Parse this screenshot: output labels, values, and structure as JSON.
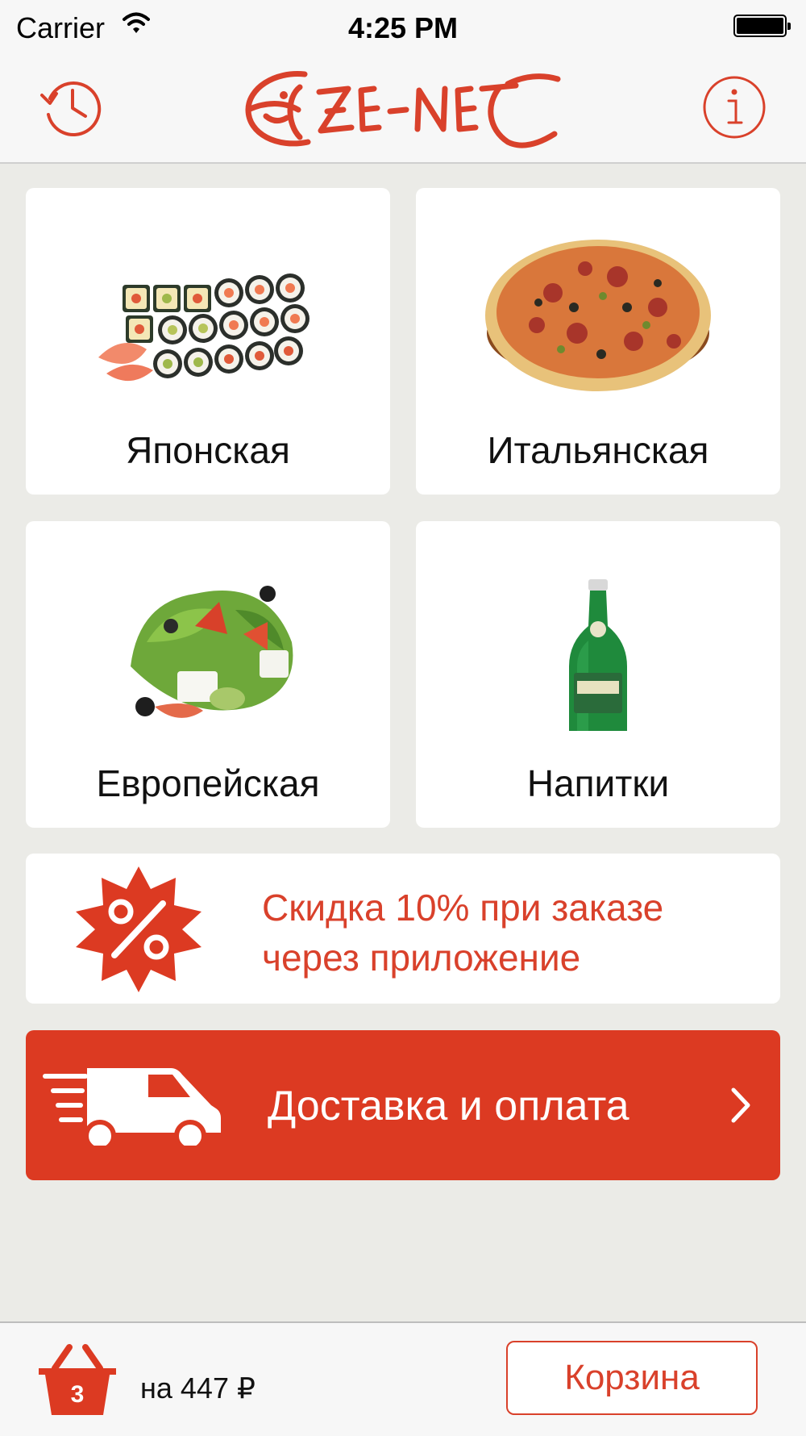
{
  "status_bar": {
    "carrier": "Carrier",
    "time": "4:25 PM"
  },
  "nav": {
    "brand": "ZENET",
    "history_icon": "history-clock-icon",
    "info_icon": "info-icon"
  },
  "categories": [
    {
      "label": "Японская",
      "icon": "sushi-image"
    },
    {
      "label": "Итальянская",
      "icon": "pizza-image"
    },
    {
      "label": "Европейская",
      "icon": "salad-image"
    },
    {
      "label": "Напитки",
      "icon": "bottle-image"
    }
  ],
  "promo": {
    "line1": "Скидка 10% при заказе",
    "line2": "через приложение",
    "icon": "percent-badge-icon"
  },
  "delivery": {
    "label": "Доставка и оплата",
    "icon": "delivery-truck-icon",
    "chevron": "chevron-right-icon"
  },
  "cart": {
    "count": "3",
    "total": "на 447 ₽",
    "button": "Корзина"
  },
  "colors": {
    "accent": "#dc3a22",
    "text_accent": "#d9412b",
    "background": "#ebebe7",
    "bar": "#f7f7f7"
  }
}
